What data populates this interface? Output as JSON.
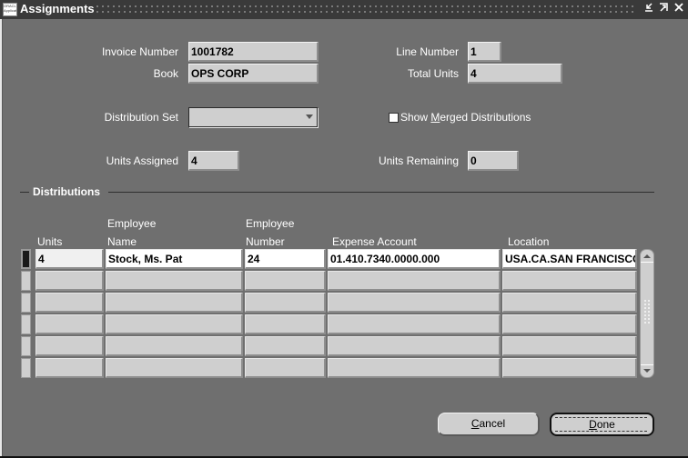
{
  "window": {
    "title": "Assignments",
    "app_icon": "oracle-logo-icon",
    "controls": {
      "minimize": "minimize-icon",
      "maximize": "maximize-icon",
      "close": "close-icon"
    }
  },
  "header": {
    "invoice_number": {
      "label": "Invoice Number",
      "value": "1001782"
    },
    "book": {
      "label": "Book",
      "value": "OPS CORP"
    },
    "line_number": {
      "label": "Line Number",
      "value": "1"
    },
    "total_units": {
      "label": "Total Units",
      "value": "4"
    },
    "distribution_set": {
      "label": "Distribution Set",
      "value": ""
    },
    "show_merged": {
      "label_pre": "Show ",
      "label_mnemonic": "M",
      "label_post": "erged Distributions",
      "checked": false
    },
    "units_assigned": {
      "label": "Units Assigned",
      "value": "4"
    },
    "units_remaining": {
      "label": "Units Remaining",
      "value": "0"
    }
  },
  "distributions": {
    "title": "Distributions",
    "columns": [
      {
        "line1": "",
        "line2": "Units"
      },
      {
        "line1": "Employee",
        "line2": "Name"
      },
      {
        "line1": "Employee",
        "line2": "Number"
      },
      {
        "line1": "",
        "line2": "Expense Account"
      },
      {
        "line1": "",
        "line2": "Location"
      }
    ],
    "rows": [
      {
        "units": "4",
        "employee_name": "Stock, Ms. Pat",
        "employee_number": "24",
        "expense_account": "01.410.7340.0000.000",
        "location": "USA.CA.SAN FRANCISCO"
      },
      {
        "units": "",
        "employee_name": "",
        "employee_number": "",
        "expense_account": "",
        "location": ""
      },
      {
        "units": "",
        "employee_name": "",
        "employee_number": "",
        "expense_account": "",
        "location": ""
      },
      {
        "units": "",
        "employee_name": "",
        "employee_number": "",
        "expense_account": "",
        "location": ""
      },
      {
        "units": "",
        "employee_name": "",
        "employee_number": "",
        "expense_account": "",
        "location": ""
      },
      {
        "units": "",
        "employee_name": "",
        "employee_number": "",
        "expense_account": "",
        "location": ""
      }
    ]
  },
  "buttons": {
    "cancel": {
      "mnemonic": "C",
      "rest": "ancel"
    },
    "done": {
      "mnemonic": "D",
      "rest": "one"
    }
  }
}
